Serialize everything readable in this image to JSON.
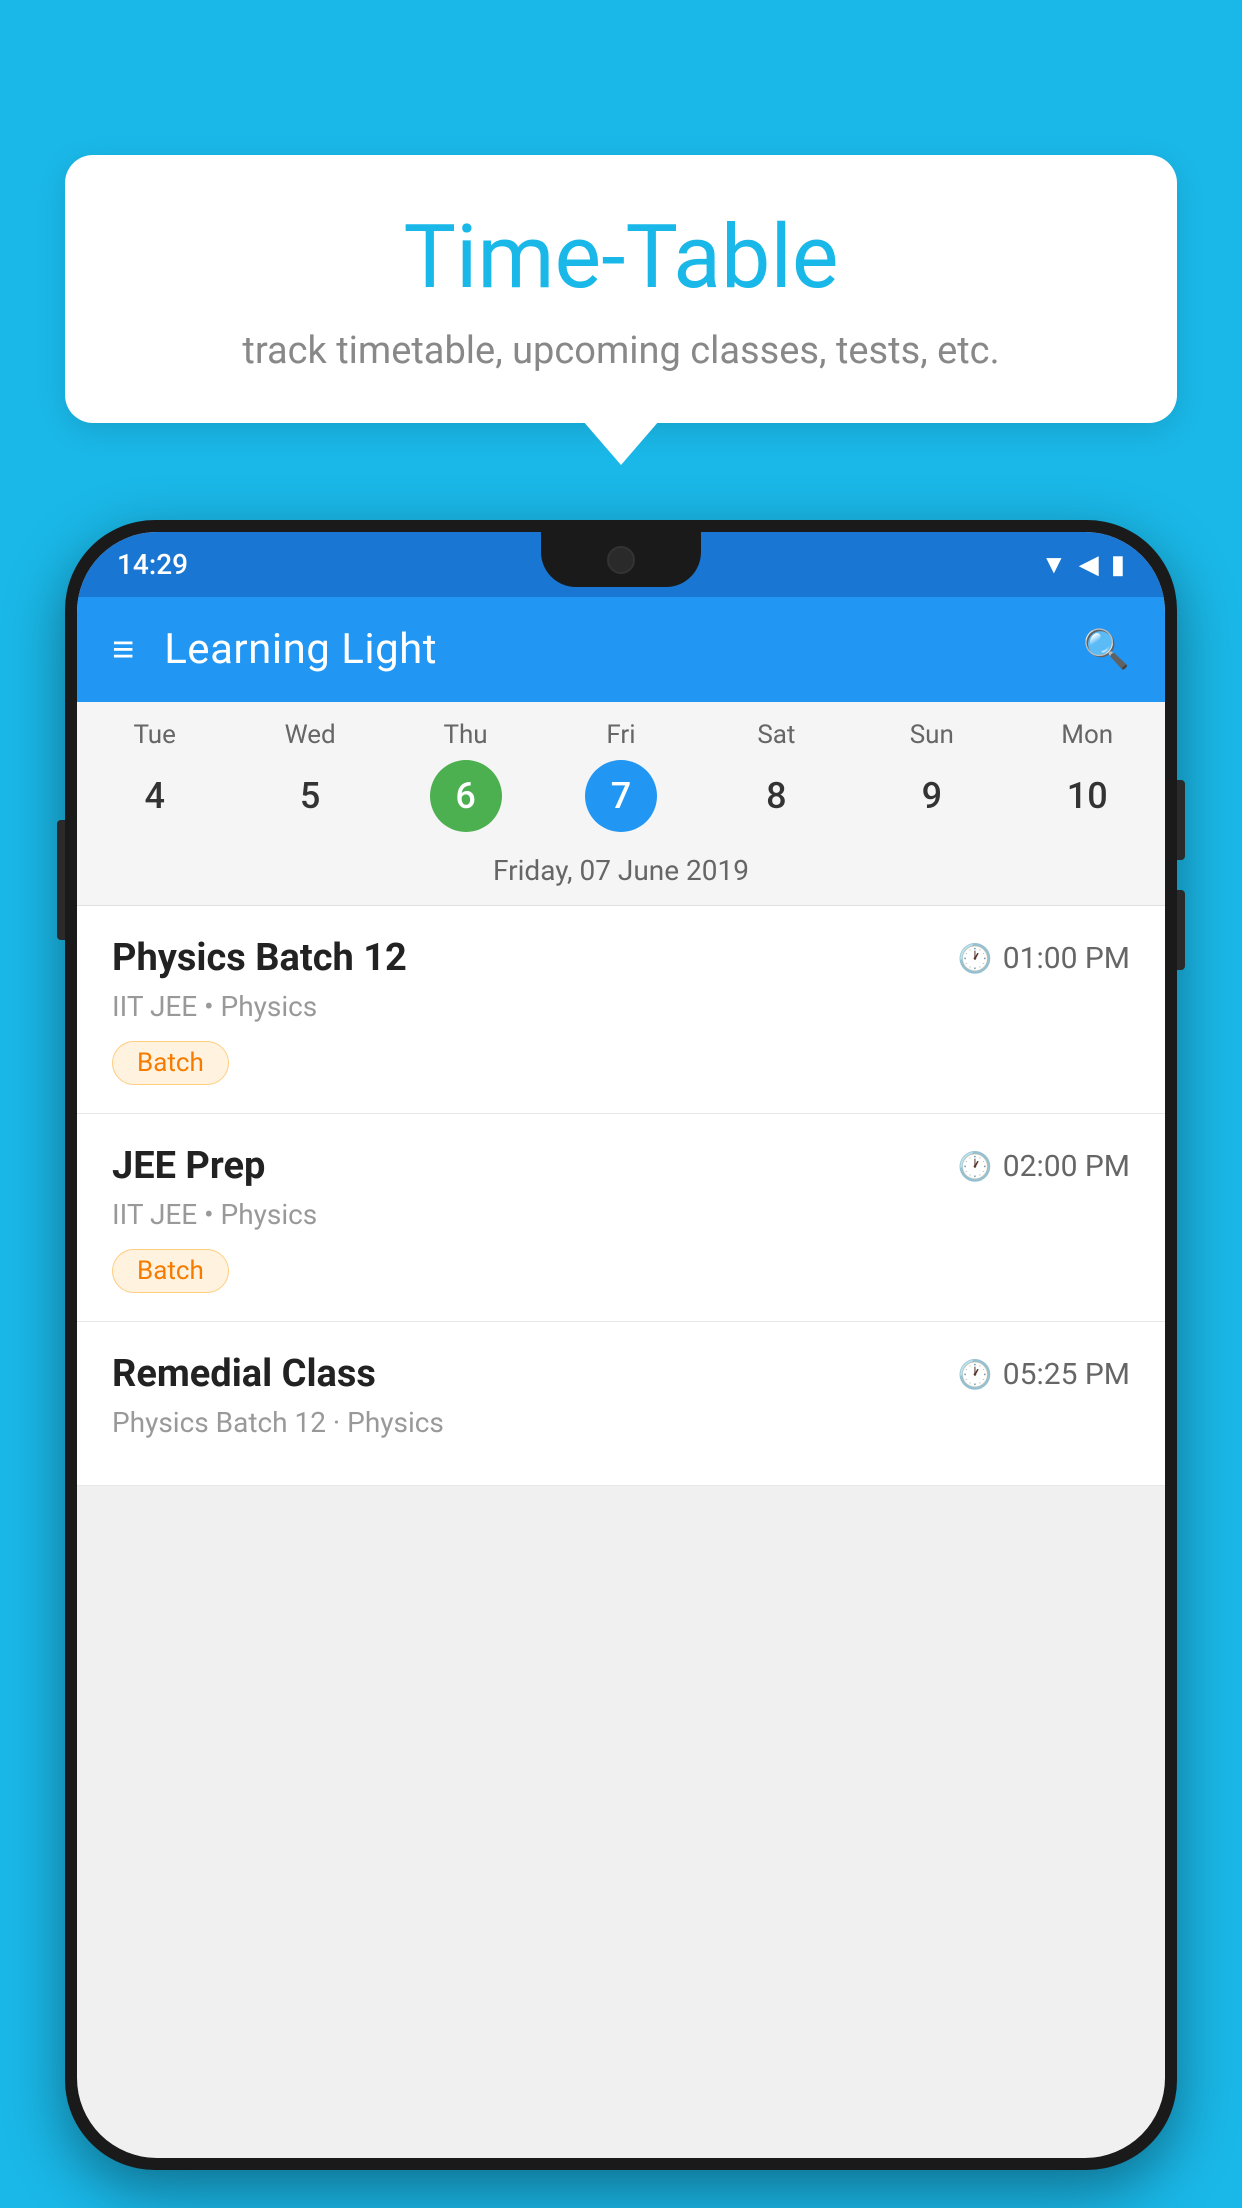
{
  "background_color": "#1AB8E8",
  "tooltip": {
    "title": "Time-Table",
    "subtitle": "track timetable, upcoming classes, tests, etc."
  },
  "phone": {
    "status_bar": {
      "time": "14:29"
    },
    "app_bar": {
      "title": "Learning Light"
    },
    "calendar": {
      "days": [
        {
          "label": "Tue",
          "num": "4",
          "state": "normal"
        },
        {
          "label": "Wed",
          "num": "5",
          "state": "normal"
        },
        {
          "label": "Thu",
          "num": "6",
          "state": "today"
        },
        {
          "label": "Fri",
          "num": "7",
          "state": "selected"
        },
        {
          "label": "Sat",
          "num": "8",
          "state": "normal"
        },
        {
          "label": "Sun",
          "num": "9",
          "state": "normal"
        },
        {
          "label": "Mon",
          "num": "10",
          "state": "normal"
        }
      ],
      "selected_date_label": "Friday, 07 June 2019"
    },
    "schedule": [
      {
        "title": "Physics Batch 12",
        "time": "01:00 PM",
        "subtitle": "IIT JEE • Physics",
        "tag": "Batch"
      },
      {
        "title": "JEE Prep",
        "time": "02:00 PM",
        "subtitle": "IIT JEE • Physics",
        "tag": "Batch"
      },
      {
        "title": "Remedial Class",
        "time": "05:25 PM",
        "subtitle": "Physics Batch 12 · Physics",
        "tag": ""
      }
    ]
  }
}
